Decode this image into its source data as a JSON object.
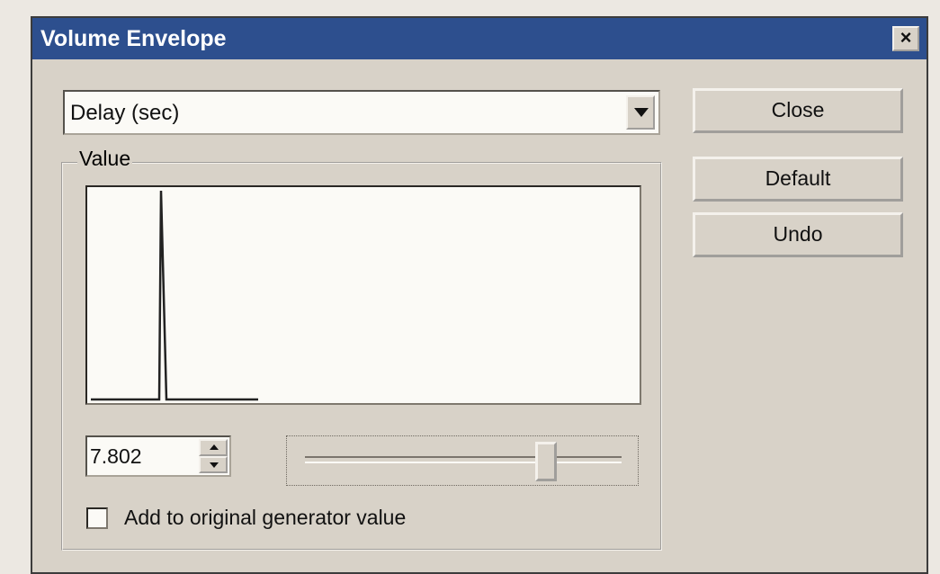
{
  "dialog": {
    "title": "Volume Envelope",
    "close_icon": "close-x-icon"
  },
  "combo": {
    "selected": "Delay (sec)",
    "icon": "dropdown-arrow-icon"
  },
  "buttons": {
    "close": "Close",
    "default": "Default",
    "undo": "Undo"
  },
  "value_group": {
    "label": "Value",
    "spin_value": "7.802",
    "slider_fraction": 0.76,
    "checkbox_label": "Add to original generator value",
    "checkbox_checked": false
  }
}
